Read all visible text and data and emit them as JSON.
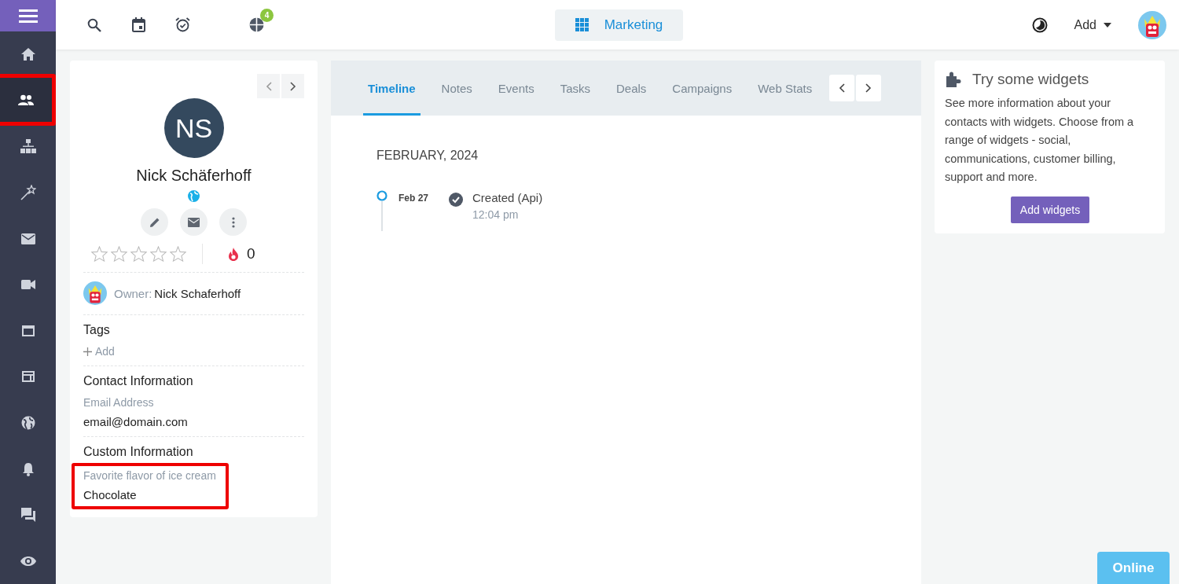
{
  "topbar": {
    "icons": [
      {
        "kind": "search"
      },
      {
        "kind": "calendar"
      },
      {
        "kind": "alarm"
      },
      {
        "kind": "chart",
        "badge": "4"
      }
    ],
    "workspace": "Marketing",
    "add_menu": "Add"
  },
  "sidebar": {
    "items": [
      {
        "kind": "home",
        "selected": false,
        "highlighted": false
      },
      {
        "kind": "contacts",
        "selected": true,
        "highlighted": true
      },
      {
        "kind": "hierarchy",
        "selected": false,
        "highlighted": false
      },
      {
        "kind": "wand",
        "selected": false,
        "highlighted": false
      },
      {
        "kind": "mail",
        "selected": false,
        "highlighted": false
      },
      {
        "kind": "video",
        "selected": false,
        "highlighted": false
      },
      {
        "kind": "window",
        "selected": false,
        "highlighted": false
      },
      {
        "kind": "card",
        "selected": false,
        "highlighted": false
      },
      {
        "kind": "globe",
        "selected": false,
        "highlighted": false
      },
      {
        "kind": "bell",
        "selected": false,
        "highlighted": false
      },
      {
        "kind": "chat",
        "selected": false,
        "highlighted": false
      },
      {
        "kind": "eye",
        "selected": false,
        "highlighted": false
      }
    ]
  },
  "contact": {
    "initials": "NS",
    "name": "Nick Schäferhoff",
    "stars": 0,
    "score": "0",
    "owner_label": "Owner:",
    "owner_name": "Nick Schaferhoff",
    "tags_title": "Tags",
    "tags_add": "Add",
    "contact_title": "Contact Information",
    "fields": [
      {
        "label": "Email Address",
        "value": "email@domain.com",
        "highlighted": false
      }
    ],
    "custom_title": "Custom Information",
    "custom_fields": [
      {
        "label": "Favorite flavor of ice cream",
        "value": "Chocolate",
        "highlighted": true
      }
    ]
  },
  "tabs": [
    {
      "label": "Timeline",
      "selected": true
    },
    {
      "label": "Notes",
      "selected": false
    },
    {
      "label": "Events",
      "selected": false
    },
    {
      "label": "Tasks",
      "selected": false
    },
    {
      "label": "Deals",
      "selected": false
    },
    {
      "label": "Campaigns",
      "selected": false
    },
    {
      "label": "Web Stats",
      "selected": false
    }
  ],
  "timeline": {
    "month": "FEBRUARY, 2024",
    "entries": [
      {
        "date": "Feb 27",
        "title": "Created (Api)",
        "time": "12:04 pm"
      }
    ]
  },
  "widgets": {
    "title": "Try some widgets",
    "text": "See more information about your contacts with widgets. Choose from a range of widgets - social, communications, customer billing, support and more.",
    "button": "Add widgets"
  },
  "chat_button": "Online"
}
